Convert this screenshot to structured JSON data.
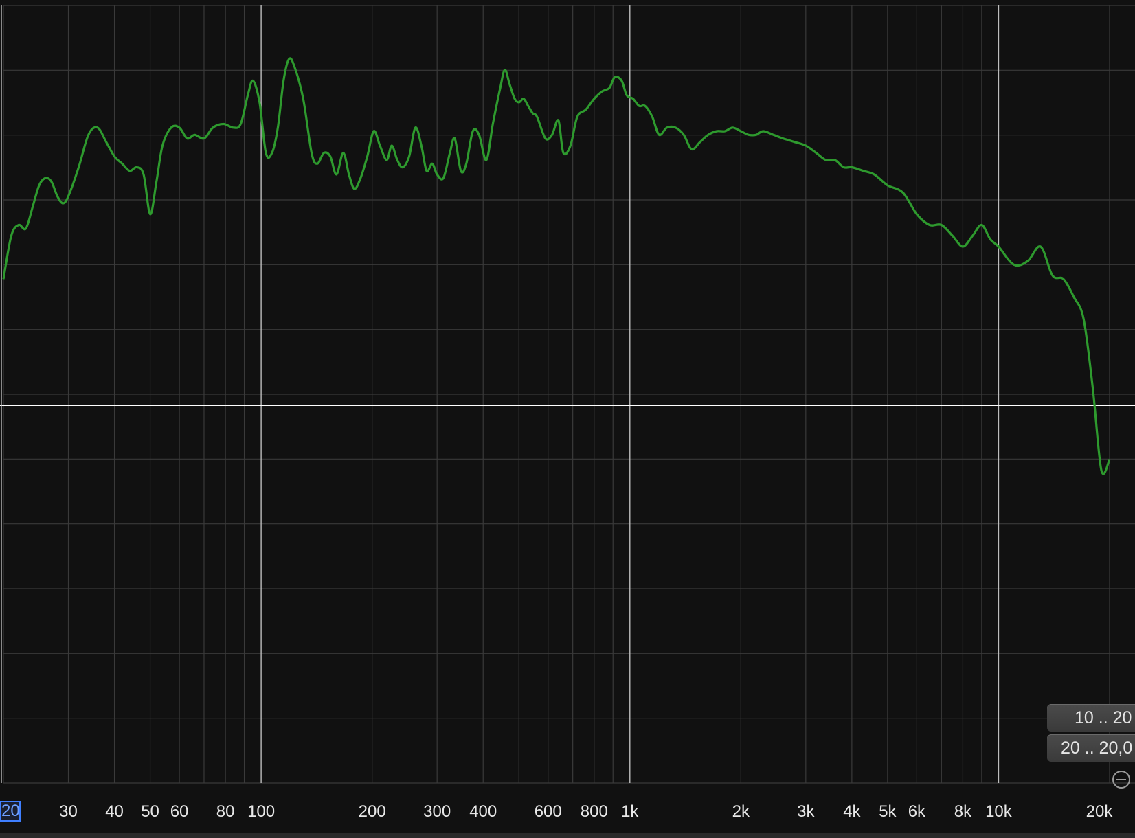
{
  "analyzer": {
    "freq_field_value": "20.0",
    "x_tick_labels": [
      {
        "f": 30,
        "label": "30"
      },
      {
        "f": 40,
        "label": "40"
      },
      {
        "f": 50,
        "label": "50"
      },
      {
        "f": 60,
        "label": "60"
      },
      {
        "f": 80,
        "label": "80"
      },
      {
        "f": 100,
        "label": "100"
      },
      {
        "f": 200,
        "label": "200"
      },
      {
        "f": 300,
        "label": "300"
      },
      {
        "f": 400,
        "label": "400"
      },
      {
        "f": 600,
        "label": "600"
      },
      {
        "f": 800,
        "label": "800"
      },
      {
        "f": 1000,
        "label": "1k"
      },
      {
        "f": 2000,
        "label": "2k"
      },
      {
        "f": 3000,
        "label": "3k"
      },
      {
        "f": 4000,
        "label": "4k"
      },
      {
        "f": 5000,
        "label": "5k"
      },
      {
        "f": 6000,
        "label": "6k"
      },
      {
        "f": 8000,
        "label": "8k"
      },
      {
        "f": 10000,
        "label": "10k"
      },
      {
        "f": 20000,
        "label": "20k"
      }
    ],
    "range_buttons": [
      "10 .. 20",
      "20 .. 20,0"
    ],
    "zoom_icon": "zoom-out-icon",
    "colors": {
      "background": "#111111",
      "grid_major": "#bdbdbd",
      "grid_minor": "#3a3a3a",
      "curve": "#2e9a2e",
      "zero_line": "#ffffff"
    }
  },
  "chart_data": {
    "type": "line",
    "x_scale": "log",
    "x_range_hz": [
      20,
      20000
    ],
    "y_range_relative": [
      -1,
      1
    ],
    "grid": true,
    "series": [
      {
        "points": [
          [
            20,
            0.35
          ],
          [
            21,
            0.47
          ],
          [
            22,
            0.5
          ],
          [
            23,
            0.49
          ],
          [
            24,
            0.55
          ],
          [
            25,
            0.61
          ],
          [
            26,
            0.63
          ],
          [
            27,
            0.62
          ],
          [
            28,
            0.58
          ],
          [
            29,
            0.56
          ],
          [
            30,
            0.58
          ],
          [
            32,
            0.66
          ],
          [
            34,
            0.75
          ],
          [
            36,
            0.77
          ],
          [
            38,
            0.73
          ],
          [
            40,
            0.69
          ],
          [
            42,
            0.67
          ],
          [
            44,
            0.65
          ],
          [
            46,
            0.66
          ],
          [
            48,
            0.64
          ],
          [
            50,
            0.53
          ],
          [
            52,
            0.62
          ],
          [
            54,
            0.72
          ],
          [
            57,
            0.77
          ],
          [
            60,
            0.77
          ],
          [
            63,
            0.74
          ],
          [
            66,
            0.75
          ],
          [
            70,
            0.74
          ],
          [
            74,
            0.77
          ],
          [
            79,
            0.78
          ],
          [
            84,
            0.77
          ],
          [
            88,
            0.78
          ],
          [
            92,
            0.86
          ],
          [
            95,
            0.9
          ],
          [
            99,
            0.84
          ],
          [
            103,
            0.7
          ],
          [
            107,
            0.7
          ],
          [
            111,
            0.77
          ],
          [
            115,
            0.9
          ],
          [
            119,
            0.96
          ],
          [
            123,
            0.94
          ],
          [
            130,
            0.85
          ],
          [
            137,
            0.7
          ],
          [
            142,
            0.67
          ],
          [
            148,
            0.7
          ],
          [
            154,
            0.69
          ],
          [
            160,
            0.64
          ],
          [
            167,
            0.7
          ],
          [
            173,
            0.64
          ],
          [
            179,
            0.6
          ],
          [
            186,
            0.63
          ],
          [
            194,
            0.69
          ],
          [
            202,
            0.76
          ],
          [
            210,
            0.72
          ],
          [
            219,
            0.68
          ],
          [
            226,
            0.72
          ],
          [
            234,
            0.68
          ],
          [
            242,
            0.66
          ],
          [
            252,
            0.69
          ],
          [
            262,
            0.77
          ],
          [
            272,
            0.72
          ],
          [
            281,
            0.65
          ],
          [
            291,
            0.67
          ],
          [
            300,
            0.64
          ],
          [
            312,
            0.63
          ],
          [
            325,
            0.7
          ],
          [
            335,
            0.74
          ],
          [
            348,
            0.65
          ],
          [
            360,
            0.67
          ],
          [
            375,
            0.76
          ],
          [
            390,
            0.75
          ],
          [
            408,
            0.68
          ],
          [
            425,
            0.78
          ],
          [
            445,
            0.88
          ],
          [
            458,
            0.93
          ],
          [
            472,
            0.89
          ],
          [
            487,
            0.85
          ],
          [
            500,
            0.84
          ],
          [
            515,
            0.85
          ],
          [
            530,
            0.83
          ],
          [
            545,
            0.81
          ],
          [
            560,
            0.8
          ],
          [
            590,
            0.74
          ],
          [
            615,
            0.75
          ],
          [
            640,
            0.79
          ],
          [
            660,
            0.7
          ],
          [
            690,
            0.72
          ],
          [
            720,
            0.8
          ],
          [
            760,
            0.82
          ],
          [
            800,
            0.85
          ],
          [
            840,
            0.87
          ],
          [
            880,
            0.88
          ],
          [
            910,
            0.91
          ],
          [
            950,
            0.9
          ],
          [
            980,
            0.86
          ],
          [
            1020,
            0.85
          ],
          [
            1060,
            0.83
          ],
          [
            1100,
            0.83
          ],
          [
            1150,
            0.8
          ],
          [
            1200,
            0.75
          ],
          [
            1260,
            0.77
          ],
          [
            1330,
            0.77
          ],
          [
            1400,
            0.75
          ],
          [
            1470,
            0.71
          ],
          [
            1550,
            0.73
          ],
          [
            1630,
            0.75
          ],
          [
            1720,
            0.76
          ],
          [
            1810,
            0.76
          ],
          [
            1900,
            0.77
          ],
          [
            2000,
            0.76
          ],
          [
            2100,
            0.75
          ],
          [
            2200,
            0.75
          ],
          [
            2300,
            0.76
          ],
          [
            2450,
            0.75
          ],
          [
            2600,
            0.74
          ],
          [
            2800,
            0.73
          ],
          [
            3000,
            0.72
          ],
          [
            3200,
            0.7
          ],
          [
            3400,
            0.68
          ],
          [
            3600,
            0.68
          ],
          [
            3800,
            0.66
          ],
          [
            4000,
            0.66
          ],
          [
            4300,
            0.65
          ],
          [
            4600,
            0.64
          ],
          [
            5000,
            0.61
          ],
          [
            5500,
            0.59
          ],
          [
            6000,
            0.53
          ],
          [
            6500,
            0.5
          ],
          [
            7000,
            0.5
          ],
          [
            7500,
            0.47
          ],
          [
            8000,
            0.44
          ],
          [
            8500,
            0.47
          ],
          [
            9000,
            0.5
          ],
          [
            9500,
            0.46
          ],
          [
            10000,
            0.44
          ],
          [
            11000,
            0.39
          ],
          [
            12000,
            0.4
          ],
          [
            13000,
            0.44
          ],
          [
            14000,
            0.36
          ],
          [
            15000,
            0.35
          ],
          [
            16000,
            0.3
          ],
          [
            17000,
            0.24
          ],
          [
            18000,
            0.05
          ],
          [
            19000,
            -0.18
          ],
          [
            20000,
            -0.15
          ]
        ]
      }
    ]
  }
}
